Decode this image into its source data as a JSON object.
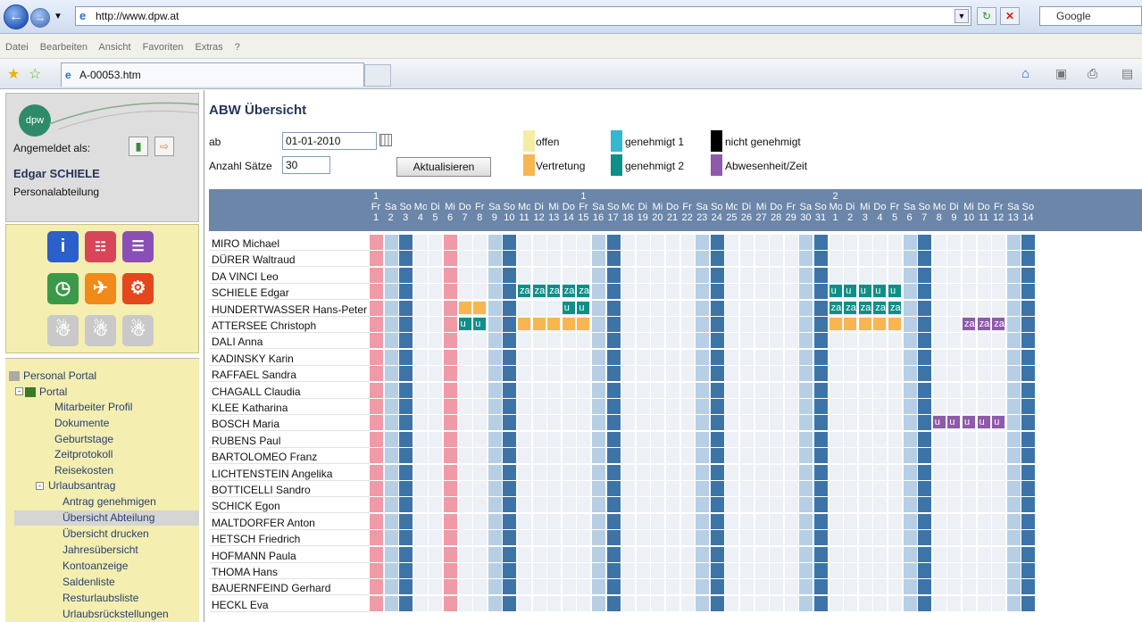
{
  "browser": {
    "url": "http://www.dpw.at",
    "search_placeholder": "Google",
    "menu": [
      "Datei",
      "Bearbeiten",
      "Ansicht",
      "Favoriten",
      "Extras",
      "?"
    ],
    "tab_title": "A-00053.htm",
    "star_icon": "star-icon",
    "add_favorites_icon": "add-favorites-icon",
    "home_icon": "home-icon",
    "feeds_icon": "feed-icon",
    "print_icon": "print-icon",
    "page_icon": "page-icon"
  },
  "sidebar": {
    "logo": "dpw",
    "logged_in_label": "Angemeldet als:",
    "user_name": "Edgar SCHIELE",
    "department": "Personalabteilung",
    "tree": {
      "root": "Personal Portal",
      "portal": "Portal",
      "items": [
        "Mitarbeiter Profil",
        "Dokumente",
        "Geburtstage",
        "Zeitprotokoll",
        "Reisekosten"
      ],
      "urlaub": "Urlaubsantrag",
      "urlaub_items": [
        "Antrag genehmigen",
        "Übersicht Abteilung",
        "Übersicht drucken",
        "Jahresübersicht",
        "Kontoanzeige",
        "Saldenliste",
        "Resturlaubsliste",
        "Urlaubsrückstellungen"
      ],
      "selected": "Übersicht Abteilung"
    }
  },
  "content": {
    "title": "ABW Übersicht",
    "ab_label": "ab",
    "date_value": "01-01-2010",
    "anzahl_label": "Anzahl Sätze",
    "anzahl_value": "30",
    "refresh_button": "Aktualisieren",
    "legend": [
      {
        "label": "offen",
        "color": "#f3eea3"
      },
      {
        "label": "Vertretung",
        "color": "#f7b64f"
      },
      {
        "label": "genehmigt 1",
        "color": "#34b8cf"
      },
      {
        "label": "genehmigt 2",
        "color": "#0f8f8a"
      },
      {
        "label": "nicht genehmigt",
        "color": "#000000"
      },
      {
        "label": "Abwesenheit/Zeit",
        "color": "#8e5aa9"
      }
    ]
  },
  "calendar": {
    "days": [
      {
        "month": "1",
        "wd": "Fr",
        "d": "1"
      },
      {
        "wd": "Sa",
        "d": "2"
      },
      {
        "wd": "So",
        "d": "3"
      },
      {
        "wd": "Mo",
        "d": "4"
      },
      {
        "wd": "Di",
        "d": "5"
      },
      {
        "wd": "Mi",
        "d": "6"
      },
      {
        "wd": "Do",
        "d": "7"
      },
      {
        "wd": "Fr",
        "d": "8"
      },
      {
        "wd": "Sa",
        "d": "9"
      },
      {
        "wd": "So",
        "d": "10"
      },
      {
        "wd": "Mo",
        "d": "11"
      },
      {
        "wd": "Di",
        "d": "12"
      },
      {
        "wd": "Mi",
        "d": "13"
      },
      {
        "wd": "Do",
        "d": "14"
      },
      {
        "month": "1",
        "wd": "Fr",
        "d": "15"
      },
      {
        "wd": "Sa",
        "d": "16"
      },
      {
        "wd": "So",
        "d": "17"
      },
      {
        "wd": "Mo",
        "d": "18"
      },
      {
        "wd": "Di",
        "d": "19"
      },
      {
        "wd": "Mi",
        "d": "20"
      },
      {
        "wd": "Do",
        "d": "21"
      },
      {
        "wd": "Fr",
        "d": "22"
      },
      {
        "wd": "Sa",
        "d": "23"
      },
      {
        "wd": "So",
        "d": "24"
      },
      {
        "wd": "Mo",
        "d": "25"
      },
      {
        "wd": "Di",
        "d": "26"
      },
      {
        "wd": "Mi",
        "d": "27"
      },
      {
        "wd": "Do",
        "d": "28"
      },
      {
        "wd": "Fr",
        "d": "29"
      },
      {
        "wd": "Sa",
        "d": "30"
      },
      {
        "wd": "So",
        "d": "31"
      },
      {
        "month": "2",
        "wd": "Mo",
        "d": "1"
      },
      {
        "wd": "Di",
        "d": "2"
      },
      {
        "wd": "Mi",
        "d": "3"
      },
      {
        "wd": "Do",
        "d": "4"
      },
      {
        "wd": "Fr",
        "d": "5"
      },
      {
        "wd": "Sa",
        "d": "6"
      },
      {
        "wd": "So",
        "d": "7"
      },
      {
        "wd": "Mo",
        "d": "8"
      },
      {
        "wd": "Di",
        "d": "9"
      },
      {
        "wd": "Mi",
        "d": "10"
      },
      {
        "wd": "Do",
        "d": "11"
      },
      {
        "wd": "Fr",
        "d": "12"
      },
      {
        "wd": "Sa",
        "d": "13"
      },
      {
        "wd": "So",
        "d": "14"
      }
    ],
    "holidays": [
      0,
      5
    ],
    "employees": [
      {
        "name": "MIRO Michael",
        "marks": []
      },
      {
        "name": "DÜRER Waltraud",
        "marks": []
      },
      {
        "name": "DA VINCI Leo",
        "marks": []
      },
      {
        "name": "SCHIELE Edgar",
        "marks": [
          {
            "day": 10,
            "code": "za",
            "status": "genehmigt 2"
          },
          {
            "day": 11,
            "code": "za",
            "status": "genehmigt 2"
          },
          {
            "day": 12,
            "code": "za",
            "status": "genehmigt 2"
          },
          {
            "day": 13,
            "code": "za",
            "status": "genehmigt 2"
          },
          {
            "day": 14,
            "code": "za",
            "status": "genehmigt 2"
          },
          {
            "day": 31,
            "code": "u",
            "status": "genehmigt 2"
          },
          {
            "day": 32,
            "code": "u",
            "status": "genehmigt 2"
          },
          {
            "day": 33,
            "code": "u",
            "status": "genehmigt 2"
          },
          {
            "day": 34,
            "code": "u",
            "status": "genehmigt 2"
          },
          {
            "day": 35,
            "code": "u",
            "status": "genehmigt 2"
          }
        ]
      },
      {
        "name": "HUNDERTWASSER Hans-Peter",
        "marks": [
          {
            "day": 6,
            "code": "",
            "status": "Vertretung"
          },
          {
            "day": 7,
            "code": "",
            "status": "Vertretung"
          },
          {
            "day": 13,
            "code": "u",
            "status": "genehmigt 2"
          },
          {
            "day": 14,
            "code": "u",
            "status": "genehmigt 2"
          },
          {
            "day": 31,
            "code": "za",
            "status": "genehmigt 2"
          },
          {
            "day": 32,
            "code": "za",
            "status": "genehmigt 2"
          },
          {
            "day": 33,
            "code": "za",
            "status": "genehmigt 2"
          },
          {
            "day": 34,
            "code": "za",
            "status": "genehmigt 2"
          },
          {
            "day": 35,
            "code": "za",
            "status": "genehmigt 2"
          }
        ]
      },
      {
        "name": "ATTERSEE Christoph",
        "marks": [
          {
            "day": 6,
            "code": "u",
            "status": "genehmigt 2"
          },
          {
            "day": 7,
            "code": "u",
            "status": "genehmigt 2"
          },
          {
            "day": 10,
            "code": "",
            "status": "Vertretung"
          },
          {
            "day": 11,
            "code": "",
            "status": "Vertretung"
          },
          {
            "day": 12,
            "code": "",
            "status": "Vertretung"
          },
          {
            "day": 13,
            "code": "",
            "status": "Vertretung"
          },
          {
            "day": 14,
            "code": "",
            "status": "Vertretung"
          },
          {
            "day": 31,
            "code": "",
            "status": "Vertretung"
          },
          {
            "day": 32,
            "code": "",
            "status": "Vertretung"
          },
          {
            "day": 33,
            "code": "",
            "status": "Vertretung"
          },
          {
            "day": 34,
            "code": "",
            "status": "Vertretung"
          },
          {
            "day": 35,
            "code": "",
            "status": "Vertretung"
          },
          {
            "day": 40,
            "code": "za",
            "status": "Abwesenheit/Zeit"
          },
          {
            "day": 41,
            "code": "za",
            "status": "Abwesenheit/Zeit"
          },
          {
            "day": 42,
            "code": "za",
            "status": "Abwesenheit/Zeit"
          }
        ]
      },
      {
        "name": "DALI Anna",
        "marks": []
      },
      {
        "name": "KADINSKY Karin",
        "marks": []
      },
      {
        "name": "RAFFAEL Sandra",
        "marks": []
      },
      {
        "name": "CHAGALL Claudia",
        "marks": []
      },
      {
        "name": "KLEE Katharina",
        "marks": []
      },
      {
        "name": "BOSCH Maria",
        "marks": [
          {
            "day": 38,
            "code": "u",
            "status": "Abwesenheit/Zeit"
          },
          {
            "day": 39,
            "code": "u",
            "status": "Abwesenheit/Zeit"
          },
          {
            "day": 40,
            "code": "u",
            "status": "Abwesenheit/Zeit"
          },
          {
            "day": 41,
            "code": "u",
            "status": "Abwesenheit/Zeit"
          },
          {
            "day": 42,
            "code": "u",
            "status": "Abwesenheit/Zeit"
          }
        ]
      },
      {
        "name": "RUBENS Paul",
        "marks": []
      },
      {
        "name": "BARTOLOMEO Franz",
        "marks": []
      },
      {
        "name": "LICHTENSTEIN Angelika",
        "marks": []
      },
      {
        "name": "BOTTICELLI Sandro",
        "marks": []
      },
      {
        "name": "SCHICK Egon",
        "marks": []
      },
      {
        "name": "MALTDORFER Anton",
        "marks": []
      },
      {
        "name": "HETSCH Friedrich",
        "marks": []
      },
      {
        "name": "HOFMANN Paula",
        "marks": []
      },
      {
        "name": "THOMA Hans",
        "marks": []
      },
      {
        "name": "BAUERNFEIND Gerhard",
        "marks": []
      },
      {
        "name": "HECKL Eva",
        "marks": []
      }
    ]
  }
}
